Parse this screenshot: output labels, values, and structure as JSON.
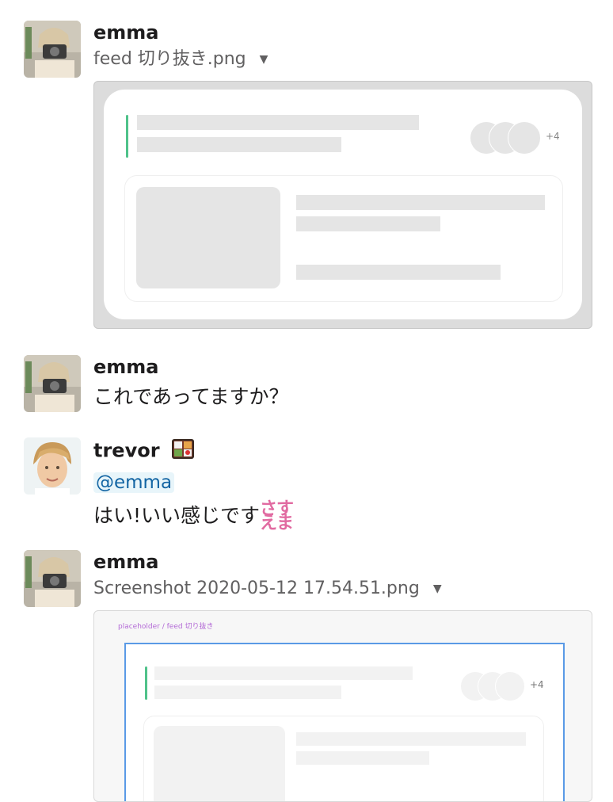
{
  "messages": [
    {
      "user": "emma",
      "file_name": "feed 切り抜き.png"
    },
    {
      "user": "emma",
      "text": "これであってますか？"
    },
    {
      "user": "trevor",
      "mention": "@emma",
      "text": "はい!いい感じです",
      "emoji_text_top": "さす",
      "emoji_text_bottom": "えま"
    },
    {
      "user": "emma",
      "file_name": "Screenshot 2020-05-12 17.54.51.png"
    }
  ],
  "preview1": {
    "count_badge": "+4"
  },
  "preview2": {
    "frame_label": "placeholder / feed 切り抜き",
    "count_badge": "+4"
  },
  "icons": {
    "caret": "chevron-down-icon",
    "bento": "bento-box-emoji"
  },
  "colors": {
    "accent_green": "#4fc28a",
    "selection_blue": "#5a9ae6",
    "mention_bg": "#e8f5fa",
    "mention_fg": "#1264a3",
    "sasuema_pink": "#e16aa1"
  }
}
